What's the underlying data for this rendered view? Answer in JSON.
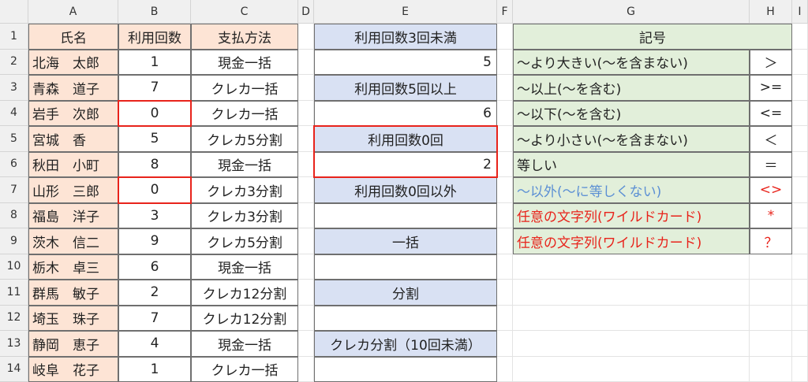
{
  "columns": [
    "A",
    "B",
    "C",
    "D",
    "E",
    "F",
    "G",
    "H",
    "I"
  ],
  "rows": [
    "1",
    "2",
    "3",
    "4",
    "5",
    "6",
    "7",
    "8",
    "9",
    "10",
    "11",
    "12",
    "13",
    "14"
  ],
  "table_a": {
    "headers": [
      "氏名",
      "利用回数",
      "支払方法"
    ],
    "rows": [
      [
        "北海　太郎",
        "1",
        "現金一括"
      ],
      [
        "青森　道子",
        "7",
        "クレカ一括"
      ],
      [
        "岩手　次郎",
        "0",
        "クレカ一括"
      ],
      [
        "宮城　香",
        "5",
        "クレカ5分割"
      ],
      [
        "秋田　小町",
        "8",
        "現金一括"
      ],
      [
        "山形　三郎",
        "0",
        "クレカ3分割"
      ],
      [
        "福島　洋子",
        "3",
        "クレカ3分割"
      ],
      [
        "茨木　信二",
        "9",
        "クレカ5分割"
      ],
      [
        "栃木　卓三",
        "6",
        "現金一括"
      ],
      [
        "群馬　敏子",
        "2",
        "クレカ12分割"
      ],
      [
        "埼玉　珠子",
        "7",
        "クレカ12分割"
      ],
      [
        "静岡　恵子",
        "4",
        "現金一括"
      ],
      [
        "岐阜　花子",
        "1",
        "クレカ一括"
      ]
    ]
  },
  "table_e": {
    "items": [
      {
        "label": "利用回数3回未満",
        "value": "5"
      },
      {
        "label": "利用回数5回以上",
        "value": "6"
      },
      {
        "label": "利用回数0回",
        "value": "2"
      },
      {
        "label": "利用回数0回以外",
        "value": ""
      },
      {
        "label": "一括",
        "value": ""
      },
      {
        "label": "分割",
        "value": ""
      },
      {
        "label": "クレカ分割（10回未満）",
        "value": ""
      }
    ]
  },
  "table_g": {
    "title": "記号",
    "rows": [
      {
        "desc": "～より大きい(～を含まない)",
        "symbol": "＞"
      },
      {
        "desc": "～以上(～を含む)",
        "symbol": ">="
      },
      {
        "desc": "～以下(～を含む)",
        "symbol": "<="
      },
      {
        "desc": "～より小さい(～を含まない)",
        "symbol": "＜"
      },
      {
        "desc": "等しい",
        "symbol": "＝"
      },
      {
        "desc": "～以外(～に等しくない)",
        "symbol": "<>"
      },
      {
        "desc": "任意の文字列(ワイルドカード)",
        "symbol": "*"
      },
      {
        "desc": "任意の文字列(ワイルドカード)",
        "symbol": "？"
      }
    ]
  },
  "colors": {
    "peach": "#fde4d5",
    "lavender": "#d9e1f3",
    "green": "#e2efda",
    "highlight_red": "#e8231b",
    "blue_text": "#5b8fd4"
  }
}
